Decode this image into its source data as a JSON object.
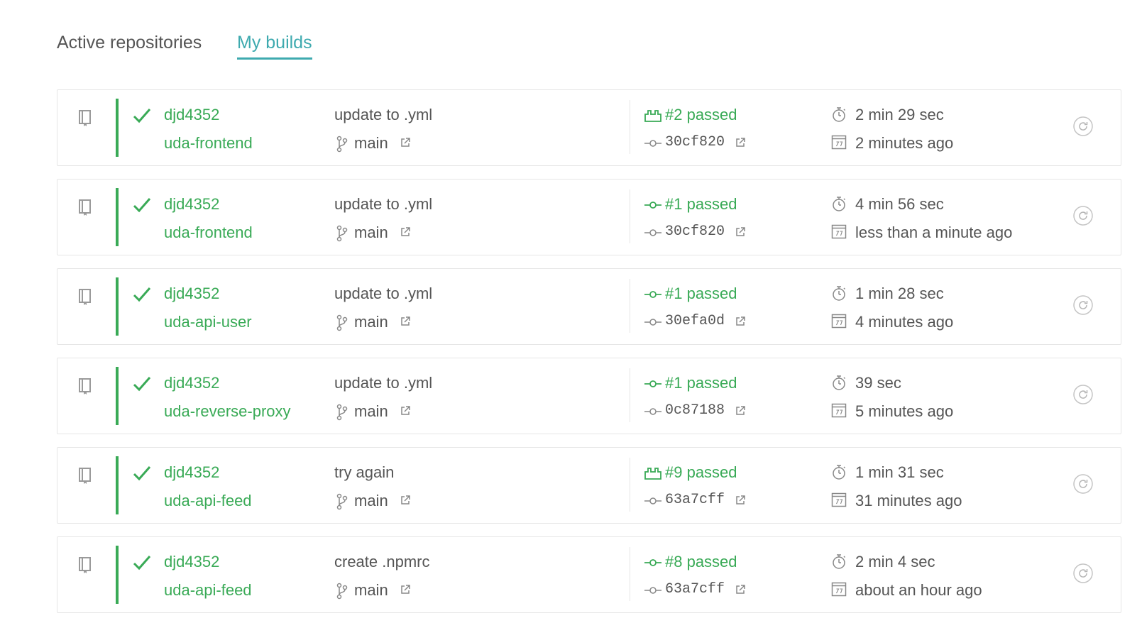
{
  "tabs": {
    "active_repositories": "Active repositories",
    "my_builds": "My builds"
  },
  "colors": {
    "passed": "#39aa56",
    "accent": "#3eaaaf",
    "text": "#555555",
    "border": "#e6e6e6"
  },
  "builds": [
    {
      "owner": "djd4352",
      "repo": "uda-frontend",
      "message": "update to .yml",
      "branch": "main",
      "build": "#2 passed",
      "build_icon": "push-icon",
      "commit": "30cf820",
      "duration": "2 min 29 sec",
      "finished": "2 minutes ago",
      "status": "passed"
    },
    {
      "owner": "djd4352",
      "repo": "uda-frontend",
      "message": "update to .yml",
      "branch": "main",
      "build": "#1 passed",
      "build_icon": "commit-icon",
      "commit": "30cf820",
      "duration": "4 min 56 sec",
      "finished": "less than a minute ago",
      "status": "passed"
    },
    {
      "owner": "djd4352",
      "repo": "uda-api-user",
      "message": "update to .yml",
      "branch": "main",
      "build": "#1 passed",
      "build_icon": "commit-icon",
      "commit": "30efa0d",
      "duration": "1 min 28 sec",
      "finished": "4 minutes ago",
      "status": "passed"
    },
    {
      "owner": "djd4352",
      "repo": "uda-reverse-proxy",
      "message": "update to .yml",
      "branch": "main",
      "build": "#1 passed",
      "build_icon": "commit-icon",
      "commit": "0c87188",
      "duration": "39 sec",
      "finished": "5 minutes ago",
      "status": "passed"
    },
    {
      "owner": "djd4352",
      "repo": "uda-api-feed",
      "message": "try again",
      "branch": "main",
      "build": "#9 passed",
      "build_icon": "push-icon",
      "commit": "63a7cff",
      "duration": "1 min 31 sec",
      "finished": "31 minutes ago",
      "status": "passed"
    },
    {
      "owner": "djd4352",
      "repo": "uda-api-feed",
      "message": "create .npmrc",
      "branch": "main",
      "build": "#8 passed",
      "build_icon": "commit-icon",
      "commit": "63a7cff",
      "duration": "2 min 4 sec",
      "finished": "about an hour ago",
      "status": "passed"
    }
  ]
}
